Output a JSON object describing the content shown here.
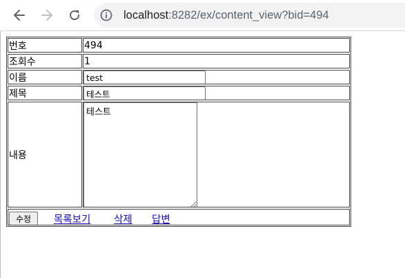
{
  "browser": {
    "url_host": "localhost",
    "url_rest": ":8282/ex/content_view?bid=494",
    "icons": {
      "back": "arrow-left-icon",
      "forward": "arrow-right-icon",
      "reload": "reload-icon",
      "info": "info-icon"
    }
  },
  "form": {
    "rows": {
      "bid": {
        "label": "번호",
        "value": "494"
      },
      "hit": {
        "label": "조회수",
        "value": "1"
      },
      "name": {
        "label": "이름",
        "value": "test"
      },
      "title": {
        "label": "제목",
        "value": "테스트"
      },
      "content": {
        "label": "내용",
        "value": "테스트"
      }
    },
    "actions": {
      "submit_label": "수정",
      "list_label": "목록보기",
      "delete_label": "삭제",
      "reply_label": "답변"
    }
  },
  "colors": {
    "link": "#1a0dab",
    "border": "#444444"
  }
}
